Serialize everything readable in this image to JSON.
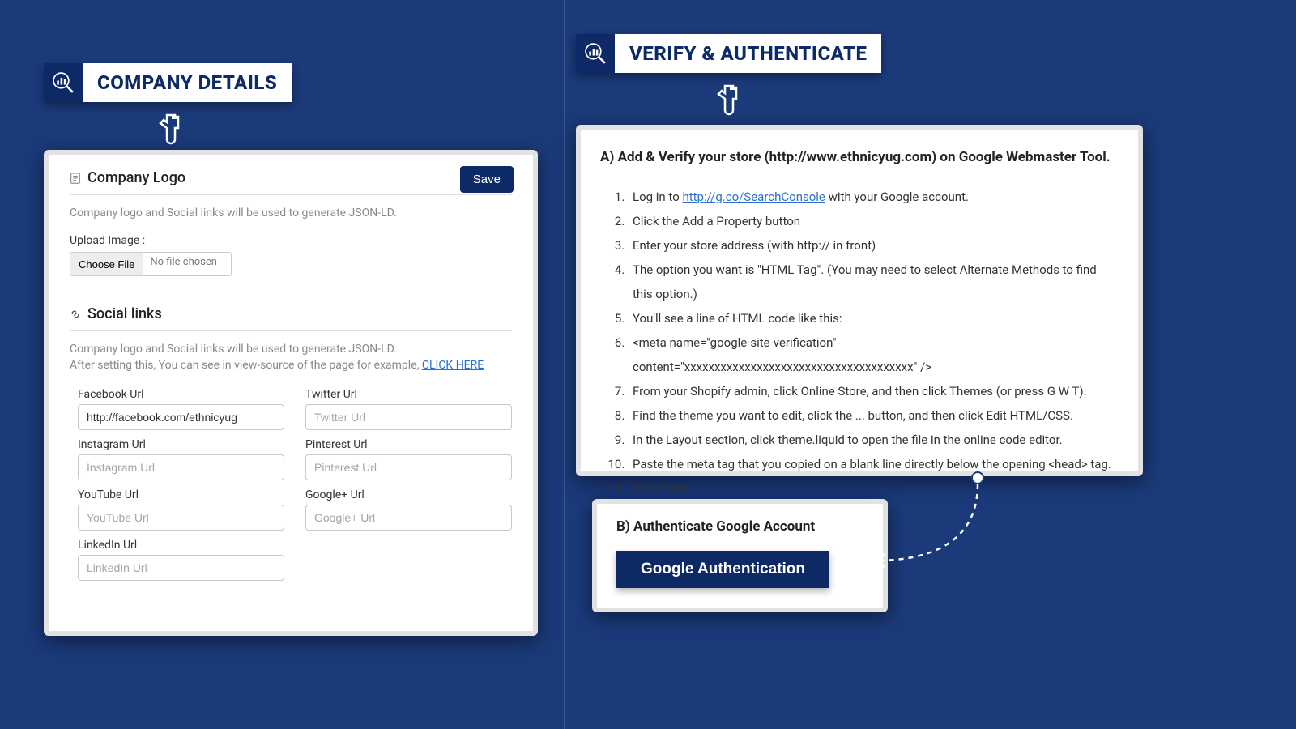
{
  "left": {
    "header": "COMPANY DETAILS",
    "card": {
      "logo_section_title": "Company Logo",
      "save_label": "Save",
      "logo_desc": "Company logo and Social links will be used to generate JSON-LD.",
      "upload_label": "Upload Image :",
      "choose_file_label": "Choose File",
      "no_file_text": "No file chosen",
      "social_title": "Social links",
      "social_desc1": "Company logo and Social links will be used to generate JSON-LD.",
      "social_desc2_prefix": "After setting this, You can see in view-source of the page for example, ",
      "social_desc2_link": "CLICK HERE",
      "fields": {
        "facebook": {
          "label": "Facebook Url",
          "value": "http://facebook.com/ethnicyug",
          "placeholder": "Facebook Url"
        },
        "twitter": {
          "label": "Twitter Url",
          "value": "",
          "placeholder": "Twitter Url"
        },
        "instagram": {
          "label": "Instagram Url",
          "value": "",
          "placeholder": "Instagram Url"
        },
        "pinterest": {
          "label": "Pinterest Url",
          "value": "",
          "placeholder": "Pinterest Url"
        },
        "youtube": {
          "label": "YouTube Url",
          "value": "",
          "placeholder": "YouTube Url"
        },
        "googleplus": {
          "label": "Google+ Url",
          "value": "",
          "placeholder": "Google+ Url"
        },
        "linkedin": {
          "label": "LinkedIn Url",
          "value": "",
          "placeholder": "LinkedIn Url"
        }
      }
    }
  },
  "right": {
    "header": "VERIFY & AUTHENTICATE",
    "cardA": {
      "title": "A) Add & Verify your store (http://www.ethnicyug.com) on Google Webmaster Tool.",
      "step1_prefix": "Log in to ",
      "step1_link": "http://g.co/SearchConsole",
      "step1_suffix": " with your Google account.",
      "steps_rest": [
        "Click the Add a Property button",
        "Enter your store address (with http:// in front)",
        "The option you want is \"HTML Tag\". (You may need to select Alternate Methods to find this option.)",
        "You'll see a line of HTML code like this:",
        "<meta name=\"google-site-verification\" content=\"xxxxxxxxxxxxxxxxxxxxxxxxxxxxxxxxxxxxxx\" />",
        "From your Shopify admin, click Online Store, and then click Themes (or press G W T).",
        "Find the theme you want to edit, click the ... button, and then click Edit HTML/CSS.",
        "In the Layout section, click theme.liquid to open the file in the online code editor.",
        "Paste the meta tag that you copied on a blank line directly below the opening <head> tag.",
        "Click Save."
      ]
    },
    "cardB": {
      "title": "B) Authenticate Google Account",
      "button": "Google Authentication"
    }
  }
}
